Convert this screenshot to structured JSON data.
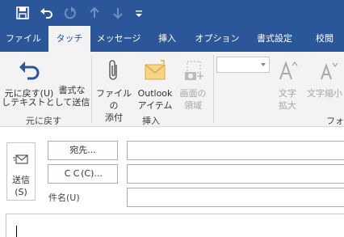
{
  "tabs": [
    "ファイル",
    "タッチ",
    "メッセージ",
    "挿入",
    "オプション",
    "書式設定",
    "校閲"
  ],
  "ribbon": {
    "undo_label_1": "元に戻す(U)",
    "undo_label_2": "",
    "clear_label_1": "書式な",
    "clear_label_2": "しテキストとして送信",
    "attach_file_1": "ファイルの",
    "attach_file_2": "添付",
    "outlook_item_1": "Outlook",
    "outlook_item_2": "アイテム",
    "screen_region_1": "画面の",
    "screen_region_2": "領域",
    "font_grow_1": "文字",
    "font_grow_2": "拡大",
    "font_shrink_1": "文字縮小",
    "group_undo": "元に戻す",
    "group_insert": "挿入",
    "group_font": "フォン"
  },
  "compose": {
    "send_1": "送信",
    "send_2": "(S)",
    "to_button": "宛先...",
    "cc_button": "ＣＣ(C)...",
    "subject_label": "件名(U)",
    "to_value": "",
    "cc_value": "",
    "subject_value": ""
  },
  "colors": {
    "brand": "#2b579a",
    "ribbon_bg": "#f3f3f3"
  }
}
